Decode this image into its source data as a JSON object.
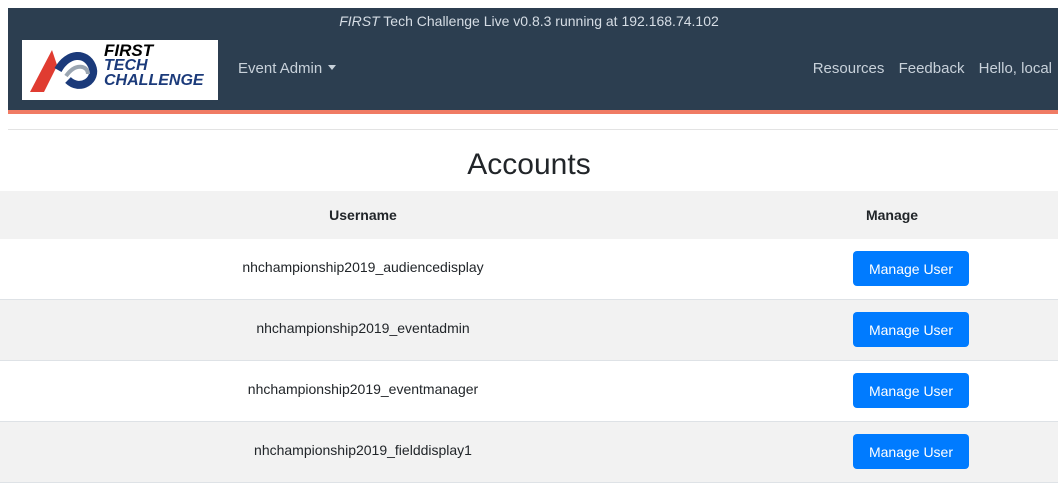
{
  "banner": {
    "prefix": "FIRST",
    "text": " Tech Challenge Live v0.8.3 running at 192.168.74.102"
  },
  "logo": {
    "line1": "FIRST",
    "line2": "TECH",
    "line3": "CHALLENGE"
  },
  "nav": {
    "dropdown_label": "Event Admin",
    "resources": "Resources",
    "feedback": "Feedback",
    "greeting": "Hello, local"
  },
  "page": {
    "title": "Accounts"
  },
  "table": {
    "headers": {
      "username": "Username",
      "manage": "Manage"
    },
    "rows": [
      {
        "username": "nhchampionship2019_audiencedisplay",
        "action": "Manage User"
      },
      {
        "username": "nhchampionship2019_eventadmin",
        "action": "Manage User"
      },
      {
        "username": "nhchampionship2019_eventmanager",
        "action": "Manage User"
      },
      {
        "username": "nhchampionship2019_fielddisplay1",
        "action": "Manage User"
      }
    ]
  },
  "colors": {
    "navbar": "#2c3e50",
    "accent_stripe": "#f07b64",
    "button": "#007bff",
    "row_stripe": "#f2f2f2"
  }
}
